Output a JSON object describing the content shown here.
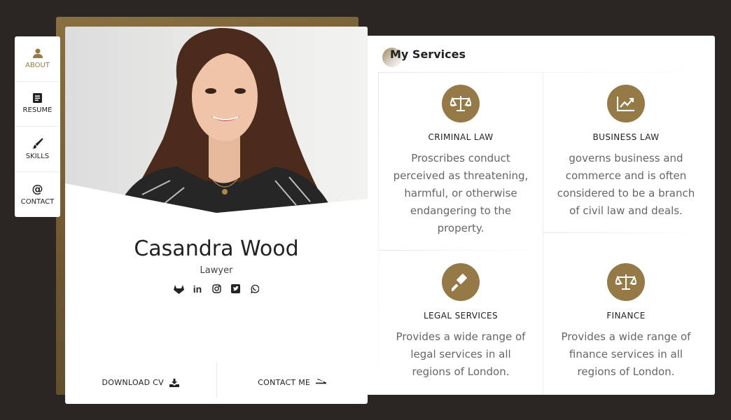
{
  "nav": [
    {
      "icon": "user-icon",
      "label": "ABOUT",
      "active": true
    },
    {
      "icon": "document-icon",
      "label": "RESUME",
      "active": false
    },
    {
      "icon": "brush-icon",
      "label": "SKILLS",
      "active": false
    },
    {
      "icon": "at-icon",
      "label": "CONTACT",
      "active": false
    }
  ],
  "profile": {
    "name": "Casandra Wood",
    "role": "Lawyer",
    "socials": [
      "gitlab-icon",
      "linkedin-icon",
      "instagram-icon",
      "twitter-icon",
      "whatsapp-icon"
    ],
    "download_cv": "DOWNLOAD CV",
    "contact_me": "CONTACT ME"
  },
  "services": {
    "title": "My Services",
    "items": [
      {
        "icon": "scales-icon",
        "name": "CRIMINAL LAW",
        "desc": "Proscribes conduct perceived as threatening, harmful, or otherwise endangering to the property."
      },
      {
        "icon": "chart-icon",
        "name": "BUSINESS LAW",
        "desc": "governs business and commerce and is often considered to be a branch of civil law and deals."
      },
      {
        "icon": "gavel-icon",
        "name": "LEGAL SERVICES",
        "desc": "Provides a wide range of legal services in all regions of London."
      },
      {
        "icon": "scales-icon",
        "name": "FINANCE",
        "desc": "Provides a wide range of finance services in all regions of London."
      }
    ]
  },
  "colors": {
    "accent": "#957a47",
    "background": "#2b2523"
  }
}
